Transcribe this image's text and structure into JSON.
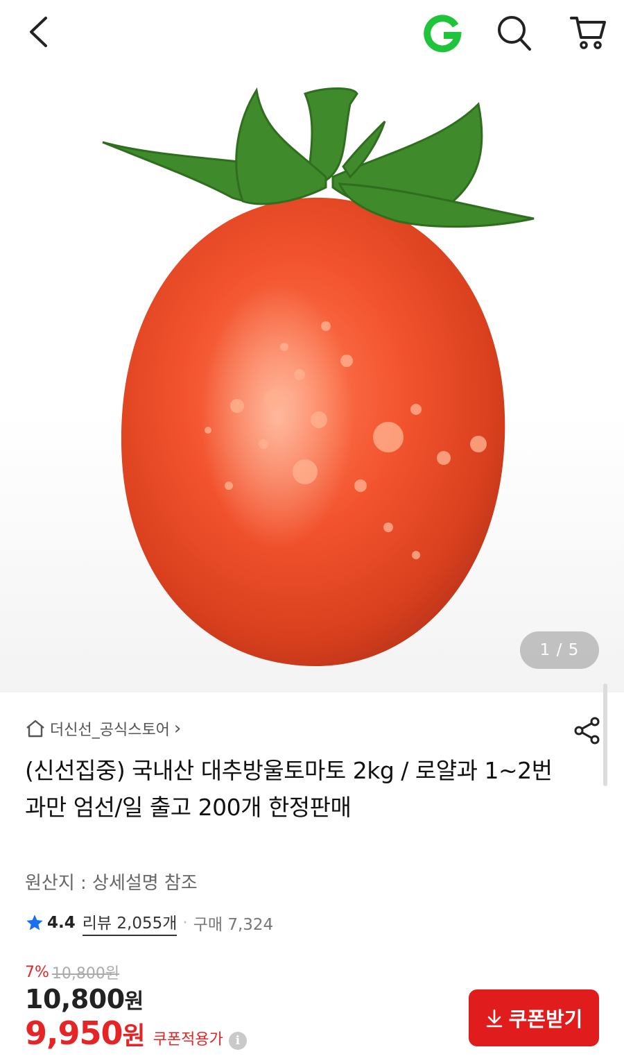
{
  "header": {
    "back_icon": "chevron-left-icon",
    "logo_letter": "G",
    "logo_color": "#1fc43a",
    "search_icon": "search-icon",
    "cart_icon": "cart-icon"
  },
  "gallery": {
    "current": "1",
    "separator": "/",
    "total": "5",
    "image_subject": "cherry-tomato"
  },
  "store": {
    "name": "더신선_공식스토어",
    "arrow": "›"
  },
  "product": {
    "title": "(신선집중) 국내산 대추방울토마토 2kg / 로얄과 1~2번과만 엄선/일 출고 200개 한정판매",
    "origin": "원산지 : 상세설명 참조"
  },
  "rating": {
    "score": "4.4",
    "reviews_label": "리뷰 2,055개",
    "dot": "·",
    "purchases_label": "구매 7,324",
    "star_color": "#1a6ef0"
  },
  "price": {
    "discount_rate": "7%",
    "original_price": "10,800원",
    "sale_price_num": "10,800",
    "sale_price_unit": "원",
    "coupon_price_num": "9,950",
    "coupon_price_unit": "원",
    "coupon_label": "쿠폰적용가",
    "info_icon": "i",
    "accent_color": "#e52525"
  },
  "coupon_button": {
    "label": "쿠폰받기",
    "icon": "download-icon"
  }
}
